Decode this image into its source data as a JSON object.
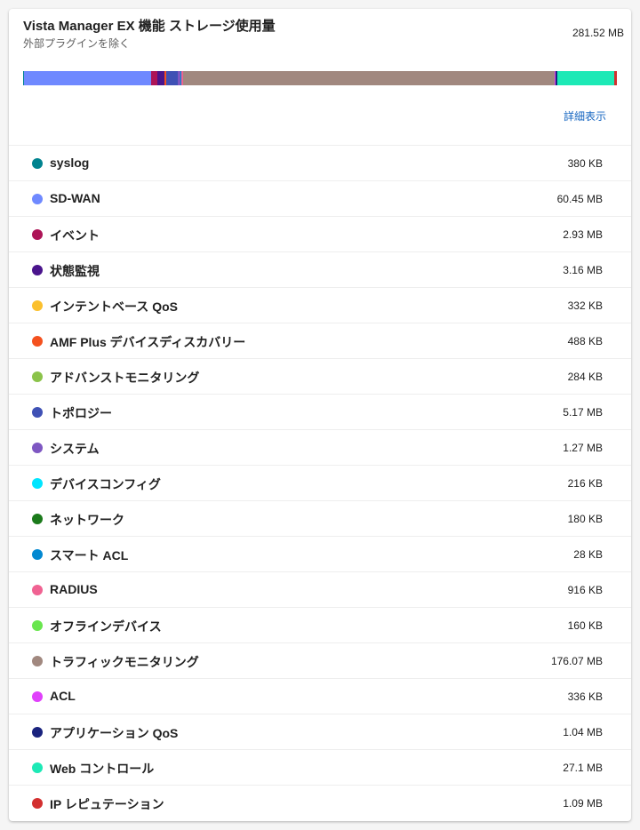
{
  "header": {
    "title": "Vista Manager EX 機能 ストレージ使用量",
    "subtitle": "外部プラグインを除く",
    "total": "281.52 MB",
    "detail_link": "詳細表示"
  },
  "items": [
    {
      "label": "syslog",
      "size": "380 KB",
      "mb": 0.371,
      "color": "#00838f"
    },
    {
      "label": "SD-WAN",
      "size": "60.45 MB",
      "mb": 60.45,
      "color": "#6f89ff"
    },
    {
      "label": "イベント",
      "size": "2.93 MB",
      "mb": 2.93,
      "color": "#ad1457"
    },
    {
      "label": "状態監視",
      "size": "3.16 MB",
      "mb": 3.16,
      "color": "#4a148c"
    },
    {
      "label": "インテントベース QoS",
      "size": "332 KB",
      "mb": 0.324,
      "color": "#fbc02d"
    },
    {
      "label": "AMF Plus デバイスディスカバリー",
      "size": "488 KB",
      "mb": 0.477,
      "color": "#f4511e"
    },
    {
      "label": "アドバンストモニタリング",
      "size": "284 KB",
      "mb": 0.277,
      "color": "#8bc34a"
    },
    {
      "label": "トポロジー",
      "size": "5.17 MB",
      "mb": 5.17,
      "color": "#3f51b5"
    },
    {
      "label": "システム",
      "size": "1.27 MB",
      "mb": 1.27,
      "color": "#7e57c2"
    },
    {
      "label": "デバイスコンフィグ",
      "size": "216 KB",
      "mb": 0.211,
      "color": "#00e5ff"
    },
    {
      "label": "ネットワーク",
      "size": "180 KB",
      "mb": 0.176,
      "color": "#1b7a1b"
    },
    {
      "label": "スマート ACL",
      "size": "28 KB",
      "mb": 0.027,
      "color": "#0288d1"
    },
    {
      "label": "RADIUS",
      "size": "916 KB",
      "mb": 0.895,
      "color": "#f06292"
    },
    {
      "label": "オフラインデバイス",
      "size": "160 KB",
      "mb": 0.156,
      "color": "#69e64e"
    },
    {
      "label": "トラフィックモニタリング",
      "size": "176.07 MB",
      "mb": 176.07,
      "color": "#a1887f"
    },
    {
      "label": "ACL",
      "size": "336 KB",
      "mb": 0.328,
      "color": "#e040fb"
    },
    {
      "label": "アプリケーション QoS",
      "size": "1.04 MB",
      "mb": 1.04,
      "color": "#1a237e"
    },
    {
      "label": "Web コントロール",
      "size": "27.1 MB",
      "mb": 27.1,
      "color": "#1de9b6"
    },
    {
      "label": "IP レピュテーション",
      "size": "1.09 MB",
      "mb": 1.09,
      "color": "#d32f2f"
    }
  ]
}
